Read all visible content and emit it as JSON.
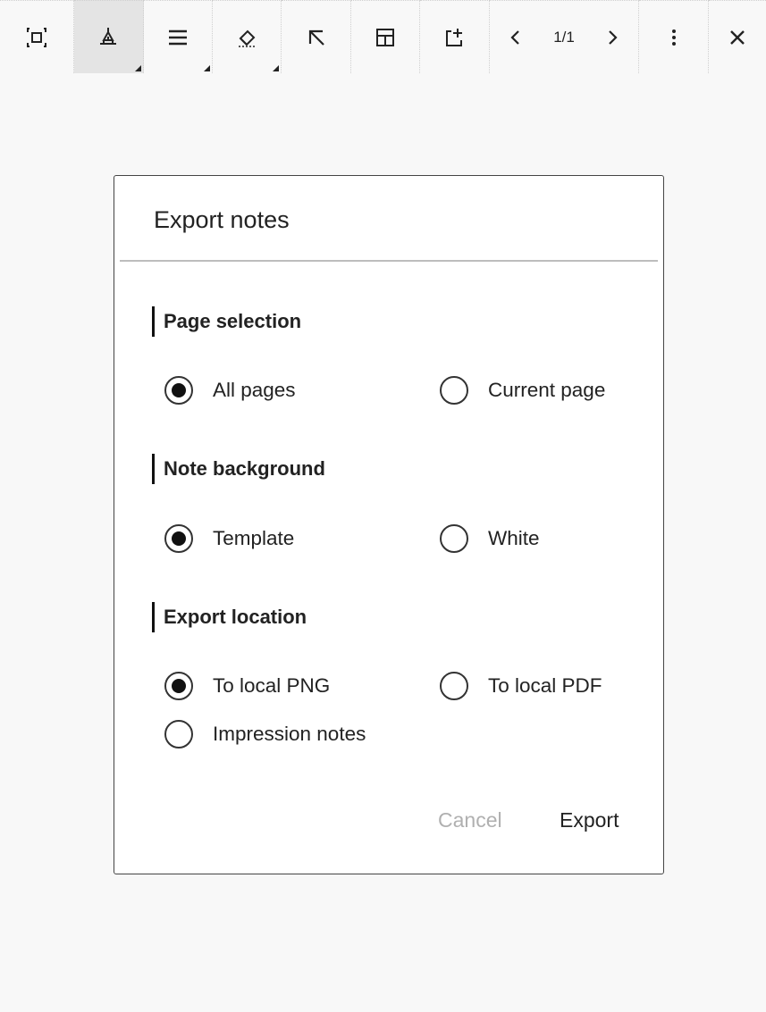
{
  "toolbar": {
    "items": [
      {
        "name": "fullscreen",
        "icon": "fullscreen-icon"
      },
      {
        "name": "pen",
        "icon": "pen-icon",
        "active": true
      },
      {
        "name": "line-width",
        "icon": "line-width-icon"
      },
      {
        "name": "eraser",
        "icon": "eraser-icon"
      },
      {
        "name": "lasso",
        "icon": "arrow-up-left-icon"
      },
      {
        "name": "layout",
        "icon": "layout-icon"
      },
      {
        "name": "add-page",
        "icon": "add-page-icon"
      }
    ],
    "page_indicator": "1/1",
    "more_icon": "more-vertical-icon",
    "close_icon": "close-icon"
  },
  "dialog": {
    "title": "Export notes",
    "sections": {
      "page_selection": {
        "label": "Page selection",
        "options": [
          {
            "label": "All pages",
            "checked": true
          },
          {
            "label": "Current page",
            "checked": false
          }
        ]
      },
      "note_background": {
        "label": "Note background",
        "options": [
          {
            "label": "Template",
            "checked": true
          },
          {
            "label": "White",
            "checked": false
          }
        ]
      },
      "export_location": {
        "label": "Export location",
        "options": [
          {
            "label": "To local PNG",
            "checked": true
          },
          {
            "label": "To local PDF",
            "checked": false
          },
          {
            "label": "Impression notes",
            "checked": false
          }
        ]
      }
    },
    "cancel_label": "Cancel",
    "export_label": "Export"
  }
}
